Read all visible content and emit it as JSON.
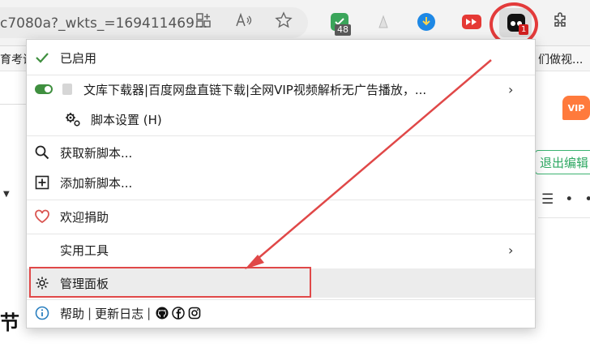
{
  "browser": {
    "url_text": "c7080a?_wkts_=169411469...",
    "extensions": {
      "counter_badge": "48",
      "tampermonkey_badge": "1"
    }
  },
  "bookmarks": {
    "left_text": "育考试",
    "right_text": "们做视..."
  },
  "background_page": {
    "exit_edit_button": "退出编辑",
    "vip_label": "VIP",
    "heading_fragment": "节"
  },
  "menu": {
    "enabled_label": "已启用",
    "script": {
      "name": "文库下载器|百度网盘直链下载|全网VIP视频解析无广告播放，..."
    },
    "script_settings_label": "脚本设置 (H)",
    "get_new_script_label": "获取新脚本...",
    "add_new_script_label": "添加新脚本...",
    "donate_label": "欢迎捐助",
    "utilities_label": "实用工具",
    "dashboard_label": "管理面板",
    "help_label": "帮助",
    "changelog_label": "更新日志",
    "separator": "|"
  },
  "colors": {
    "accent_green": "#3f8f3f",
    "annotation_red": "#e04848",
    "donate_heart": "#d9534f",
    "info_blue": "#2a7fbf"
  }
}
